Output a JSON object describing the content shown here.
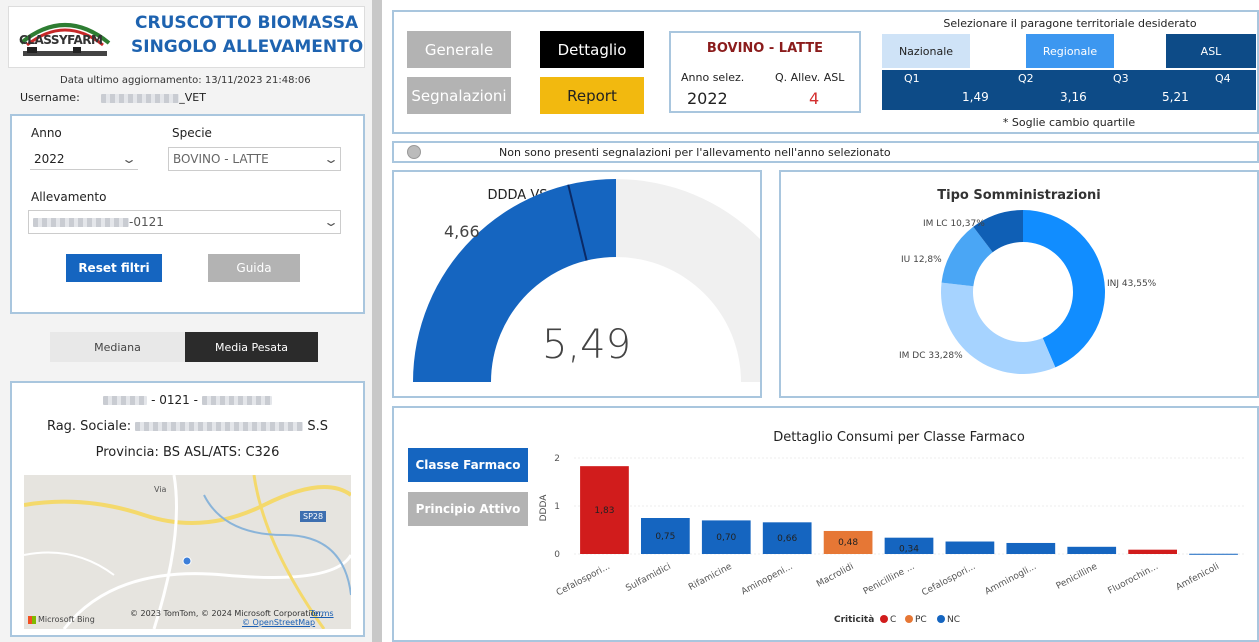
{
  "header": {
    "logo_text": "CLASSYFARM",
    "title_line1": "CRUSCOTTO BIOMASSA",
    "title_line2": "SINGOLO ALLEVAMENTO",
    "last_update": "Data ultimo aggiornamento: 13/11/2023 21:48:06",
    "username_label": "Username:",
    "username_suffix": "_VET"
  },
  "filters": {
    "anno_label": "Anno",
    "anno_value": "2022",
    "specie_label": "Specie",
    "specie_value": "BOVINO - LATTE",
    "allevamento_label": "Allevamento",
    "allevamento_value_suffix": "-0121",
    "reset_label": "Reset filtri",
    "guida_label": "Guida"
  },
  "toggle": {
    "mediana": "Mediana",
    "media_pesata": "Media Pesata"
  },
  "farm_info": {
    "code_mid": " - 0121 - ",
    "rag_label": "Rag. Sociale:",
    "rag_suffix": "S.S",
    "provincia": "Provincia: BS  ASL/ATS: C326",
    "map": {
      "road_label": "SP28",
      "place_label": "Via",
      "attribution": "© 2023 TomTom, © 2024 Microsoft Corporation,",
      "terms": "Terms",
      "osm": "© OpenStreetMap",
      "bing": "Microsoft Bing"
    }
  },
  "nav": {
    "generale": "Generale",
    "dettaglio": "Dettaglio",
    "segnalazioni": "Segnalazioni",
    "report": "Report"
  },
  "summary": {
    "species": "BOVINO - LATTE",
    "anno_label": "Anno selez.",
    "anno_value": "2022",
    "quart_label": "Q. Allev. ASL",
    "quart_value": "4"
  },
  "territorial": {
    "title": "Selezionare il paragone territoriale desiderato",
    "options": [
      "Nazionale",
      "Regionale",
      "ASL"
    ],
    "quartiles": [
      "Q1",
      "Q2",
      "Q3",
      "Q4"
    ],
    "thresholds": [
      "1,49",
      "3,16",
      "5,21"
    ],
    "note": "* Soglie cambio quartile"
  },
  "alert": {
    "text": "Non sono presenti segnalazioni per l'allevamento nell'anno selezionato"
  },
  "gauge": {
    "title": "DDDA VS Media Pesata ASL",
    "value": 5.49,
    "value_label": "5,49",
    "target": 4.66,
    "target_label": "4,66",
    "max": 10.98
  },
  "donut": {
    "title": "Tipo Somministrazioni",
    "slices": [
      {
        "label": "INJ 43,55%",
        "value": 43.55,
        "color": "#118dff"
      },
      {
        "label": "IM DC 33,28%",
        "value": 33.28,
        "color": "#a6d3ff"
      },
      {
        "label": "IU 12,8%",
        "value": 12.8,
        "color": "#4aa6f5"
      },
      {
        "label": "IM LC 10,37%",
        "value": 10.37,
        "color": "#0f5fb5"
      }
    ]
  },
  "chart_data": {
    "type": "bar",
    "title": "Dettaglio Consumi per Classe Farmaco",
    "ylabel": "DDDA",
    "ylim": [
      0,
      2
    ],
    "yticks": [
      "0",
      "1",
      "2"
    ],
    "categories": [
      "Cefalospori...",
      "Sulfamidici",
      "Rifamicine",
      "Aminopeni...",
      "Macrolidi",
      "Penicilline ...",
      "Cefalospori...",
      "Amminogli...",
      "Penicilline",
      "Fluorochin...",
      "Amfenicoli"
    ],
    "values": [
      1.83,
      0.75,
      0.7,
      0.66,
      0.48,
      0.34,
      0.26,
      0.23,
      0.15,
      0.09,
      0.005
    ],
    "value_labels": [
      "1,83",
      "0,75",
      "0,70",
      "0,66",
      "0,48",
      "0,34",
      "",
      "",
      "",
      "",
      ""
    ],
    "criticita": [
      "C",
      "NC",
      "NC",
      "NC",
      "PC",
      "NC",
      "NC",
      "NC",
      "NC",
      "C",
      "NC"
    ],
    "legend": {
      "title": "Criticità",
      "items": [
        "C",
        "PC",
        "NC"
      ],
      "colors": {
        "C": "#d11c1c",
        "PC": "#e67735",
        "NC": "#1565c0"
      }
    }
  },
  "side_buttons": {
    "classe": "Classe Farmaco",
    "principio": "Principio Attivo"
  }
}
